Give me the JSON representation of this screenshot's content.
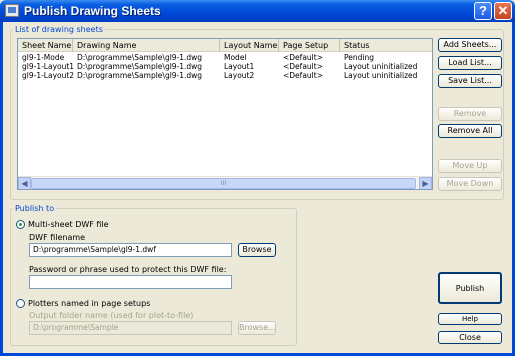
{
  "window": {
    "title": "Publish Drawing Sheets"
  },
  "list_group": {
    "legend": "List of drawing sheets",
    "columns": [
      "Sheet Name",
      "Drawing Name",
      "Layout Name",
      "Page Setup",
      "Status"
    ],
    "rows": [
      [
        "gl9-1-Mode",
        "D:\\programme\\Sample\\gl9-1.dwg",
        "Model",
        "<Default>",
        "Pending"
      ],
      [
        "gl9-1-Layout1",
        "D:\\programme\\Sample\\gl9-1.dwg",
        "Layout1",
        "<Default>",
        "Layout uninitialized"
      ],
      [
        "gl9-1-Layout2",
        "D:\\programme\\Sample\\gl9-1.dwg",
        "Layout2",
        "<Default>",
        "Layout uninitialized"
      ]
    ],
    "scroll_thumb_label": "III"
  },
  "side_buttons": {
    "add": "Add Sheets...",
    "load": "Load List...",
    "save": "Save List...",
    "remove": "Remove",
    "remove_all": "Remove All",
    "move_up": "Move Up",
    "move_down": "Move Down"
  },
  "publish_group": {
    "legend": "Publish to",
    "multi_label": "Multi-sheet DWF file",
    "dwf_filename_label": "DWF filename",
    "dwf_filename_value": "D:\\programme\\Sample\\gl9-1.dwf",
    "browse1": "Browse",
    "password_label": "Password or phrase used to protect this DWF file:",
    "password_value": "",
    "plotters_label": "Plotters named in page setups",
    "output_folder_label": "Output folder name (used for plot-to-file)",
    "output_folder_value": "D:\\programme\\Sample",
    "browse2": "Browse..."
  },
  "bottom_buttons": {
    "publish": "Publish",
    "help": "Help",
    "close": "Close"
  }
}
